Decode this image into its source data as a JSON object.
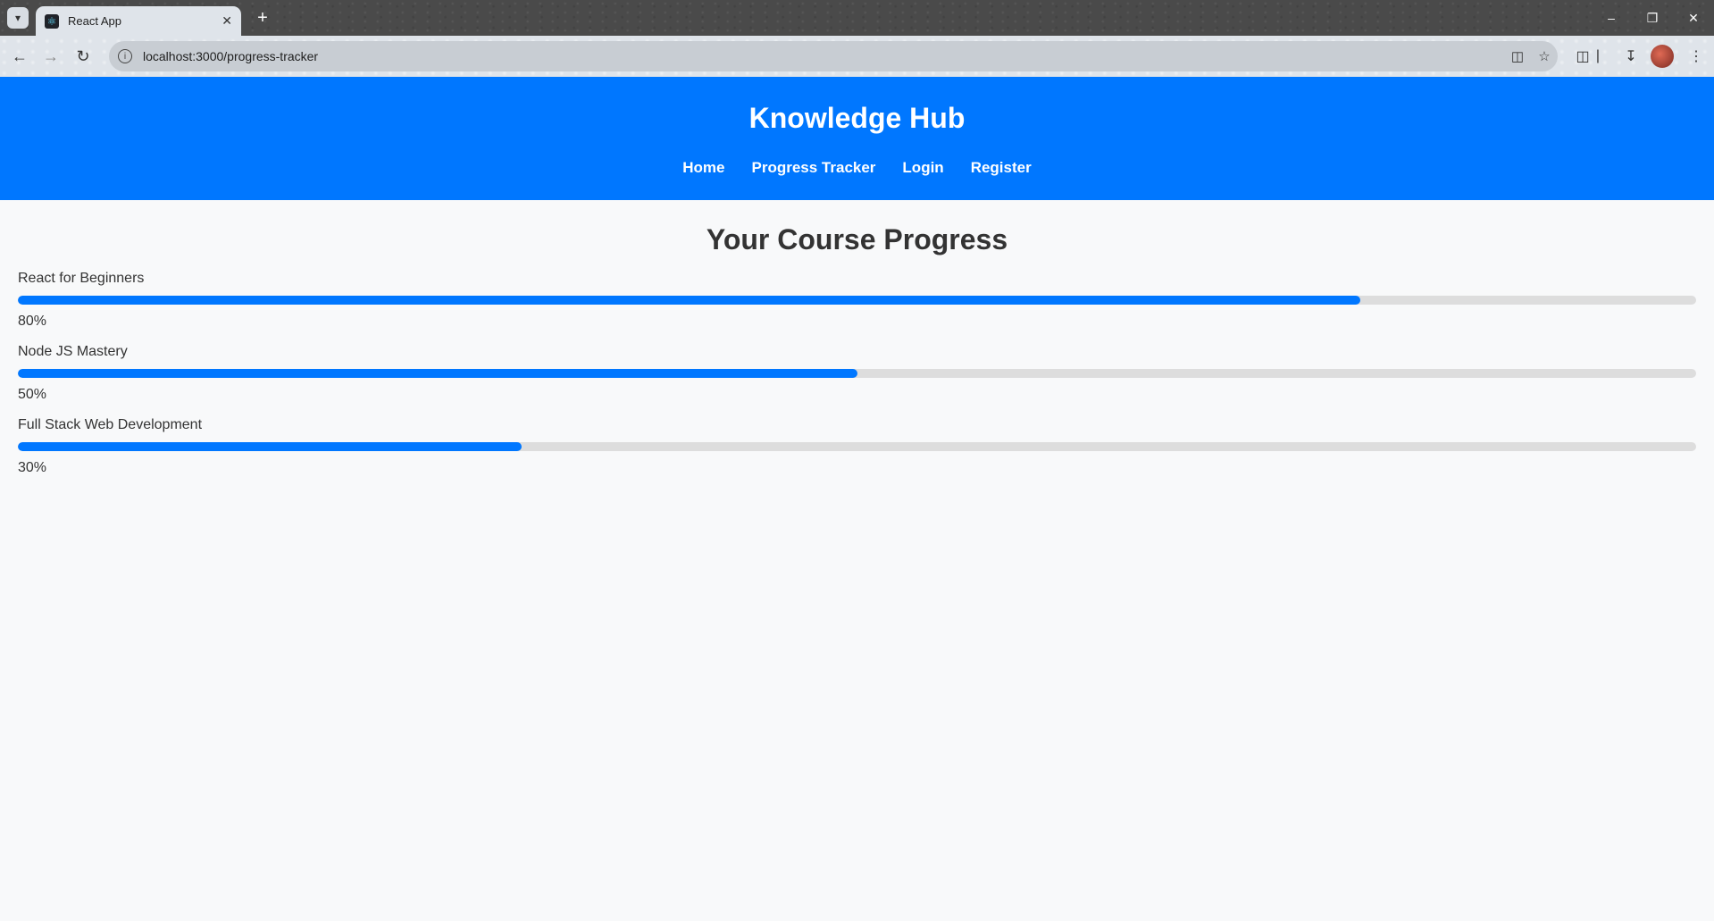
{
  "browser": {
    "tab_title": "React App",
    "url": "localhost:3000/progress-tracker"
  },
  "site": {
    "title": "Knowledge Hub",
    "nav": [
      "Home",
      "Progress Tracker",
      "Login",
      "Register"
    ]
  },
  "main": {
    "heading": "Your Course Progress",
    "courses": [
      {
        "name": "React for Beginners",
        "percent_label": "80%",
        "progress": 0.8
      },
      {
        "name": "Node JS Mastery",
        "percent_label": "50%",
        "progress": 0.5
      },
      {
        "name": "Full Stack Web Development",
        "percent_label": "30%",
        "progress": 0.3
      }
    ]
  },
  "colors": {
    "accent": "#0077ff",
    "track": "#dddddd",
    "text": "#333333",
    "page_bg": "#f8f9fa"
  },
  "icons": {
    "tab_search": "chevron-down-icon",
    "favicon": "react-icon",
    "close": "close-icon",
    "new_tab": "plus-icon",
    "back": "arrow-left-icon",
    "forward": "arrow-right-icon",
    "reload": "reload-icon",
    "site_info": "info-icon",
    "install": "install-icon",
    "bookmark": "star-icon",
    "extensions": "puzzle-icon",
    "downloads": "download-icon",
    "menu": "kebab-menu-icon"
  }
}
